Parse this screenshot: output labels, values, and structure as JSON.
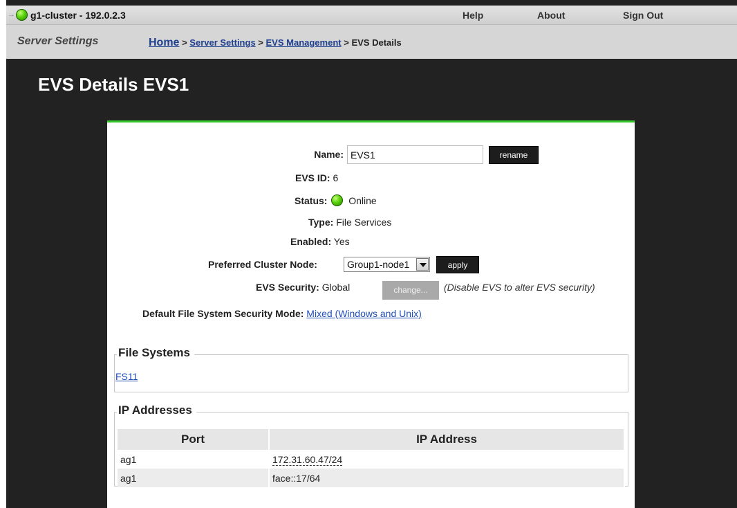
{
  "topbar": {
    "cluster_title": "g1-cluster - 192.0.2.3",
    "help": "Help",
    "about": "About",
    "sign_out": "Sign Out"
  },
  "breadcrumb": {
    "section_name": "Server Settings",
    "home": "Home",
    "sep": ">",
    "server_settings": "Server Settings",
    "evs_management": "EVS Management",
    "current": "EVS Details"
  },
  "page": {
    "title": "EVS Details EVS1"
  },
  "details": {
    "name_label": "Name:",
    "name_value": "EVS1",
    "rename_button": "rename",
    "evs_id_label": "EVS ID:",
    "evs_id_value": "6",
    "status_label": "Status:",
    "status_value": "Online",
    "type_label": "Type:",
    "type_value": "File Services",
    "enabled_label": "Enabled:",
    "enabled_value": "Yes",
    "preferred_node_label": "Preferred Cluster Node:",
    "preferred_node_value": "Group1-node1",
    "apply_button": "apply",
    "evs_security_label": "EVS Security:",
    "evs_security_value": "Global",
    "change_button": "change...",
    "evs_security_note": "(Disable EVS to alter EVS security)",
    "default_fs_security_label": "Default File System Security Mode:",
    "default_fs_security_value": "Mixed (Windows and Unix)"
  },
  "file_systems": {
    "legend": "File Systems",
    "items": [
      "FS11"
    ]
  },
  "ip_addresses": {
    "legend": "IP Addresses",
    "columns": [
      "Port",
      "IP Address"
    ],
    "rows": [
      {
        "port": "ag1",
        "ip": "172.31.60.47/24"
      },
      {
        "port": "ag1",
        "ip": "face::17/64"
      }
    ]
  },
  "colors": {
    "accent_green": "#35c42a",
    "background": "#222222",
    "link": "#1f4fb8"
  },
  "icons": {
    "status_led": "green-led-icon",
    "nav_arrow": "arrow-right-icon"
  }
}
